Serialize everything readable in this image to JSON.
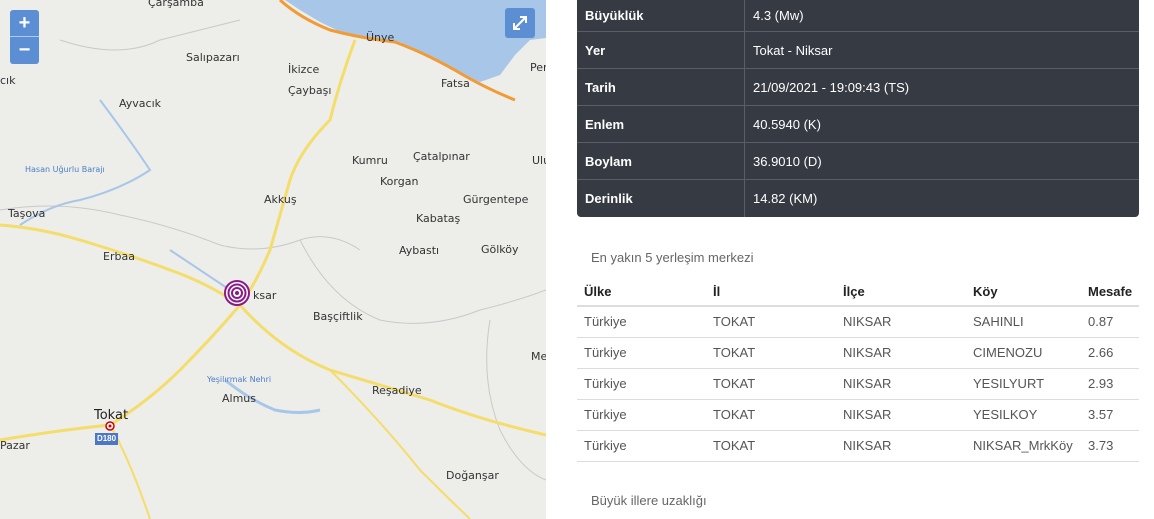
{
  "map": {
    "zoom_in": "+",
    "zoom_out": "−",
    "road_shield": "D180",
    "places": [
      {
        "name": "Çarşamba",
        "cls": ""
      },
      {
        "name": "Salıpazarı",
        "cls": ""
      },
      {
        "name": "İkizce",
        "cls": ""
      },
      {
        "name": "Çaybaşı",
        "cls": ""
      },
      {
        "name": "Ünye",
        "cls": ""
      },
      {
        "name": "Fatsa",
        "cls": ""
      },
      {
        "name": "Per",
        "cls": ""
      },
      {
        "name": "cık",
        "cls": ""
      },
      {
        "name": "Ayvacık",
        "cls": ""
      },
      {
        "name": "Hasan Uğurlu Barajı",
        "cls": "water"
      },
      {
        "name": "Kumru",
        "cls": ""
      },
      {
        "name": "Çatalpınar",
        "cls": ""
      },
      {
        "name": "Ulu",
        "cls": ""
      },
      {
        "name": "Korgan",
        "cls": ""
      },
      {
        "name": "Akkuş",
        "cls": ""
      },
      {
        "name": "Gürgentepe",
        "cls": ""
      },
      {
        "name": "Taşova",
        "cls": ""
      },
      {
        "name": "Kabataş",
        "cls": ""
      },
      {
        "name": "Aybastı",
        "cls": ""
      },
      {
        "name": "Gölköy",
        "cls": ""
      },
      {
        "name": "Erbaa",
        "cls": ""
      },
      {
        "name": "ksar",
        "cls": ""
      },
      {
        "name": "Başçiftlik",
        "cls": ""
      },
      {
        "name": "Me",
        "cls": ""
      },
      {
        "name": "Yeşilırmak Nehri",
        "cls": "water"
      },
      {
        "name": "Reşadiye",
        "cls": ""
      },
      {
        "name": "Almus",
        "cls": ""
      },
      {
        "name": "Tokat",
        "cls": "city"
      },
      {
        "name": "Pazar",
        "cls": ""
      },
      {
        "name": "Doğanşar",
        "cls": ""
      }
    ]
  },
  "details": [
    {
      "label": "Büyüklük",
      "value": "4.3 (Mw)"
    },
    {
      "label": "Yer",
      "value": "Tokat - Niksar"
    },
    {
      "label": "Tarih",
      "value": "21/09/2021 - 19:09:43 (TS)"
    },
    {
      "label": "Enlem",
      "value": "40.5940 (K)"
    },
    {
      "label": "Boylam",
      "value": "36.9010 (D)"
    },
    {
      "label": "Derinlik",
      "value": "14.82 (KM)"
    }
  ],
  "nearest_title": "En yakın 5 yerleşim merkezi",
  "nearest_headers": [
    "Ülke",
    "İl",
    "İlçe",
    "Köy",
    "Mesafe"
  ],
  "nearest_rows": [
    [
      "Türkiye",
      "TOKAT",
      "NIKSAR",
      "SAHINLI",
      "0.87"
    ],
    [
      "Türkiye",
      "TOKAT",
      "NIKSAR",
      "CIMENOZU",
      "2.66"
    ],
    [
      "Türkiye",
      "TOKAT",
      "NIKSAR",
      "YESILYURT",
      "2.93"
    ],
    [
      "Türkiye",
      "TOKAT",
      "NIKSAR",
      "YESILKOY",
      "3.57"
    ],
    [
      "Türkiye",
      "TOKAT",
      "NIKSAR",
      "NIKSAR_MrkKöy",
      "3.73"
    ]
  ],
  "cities_title": "Büyük illere uzaklığı"
}
